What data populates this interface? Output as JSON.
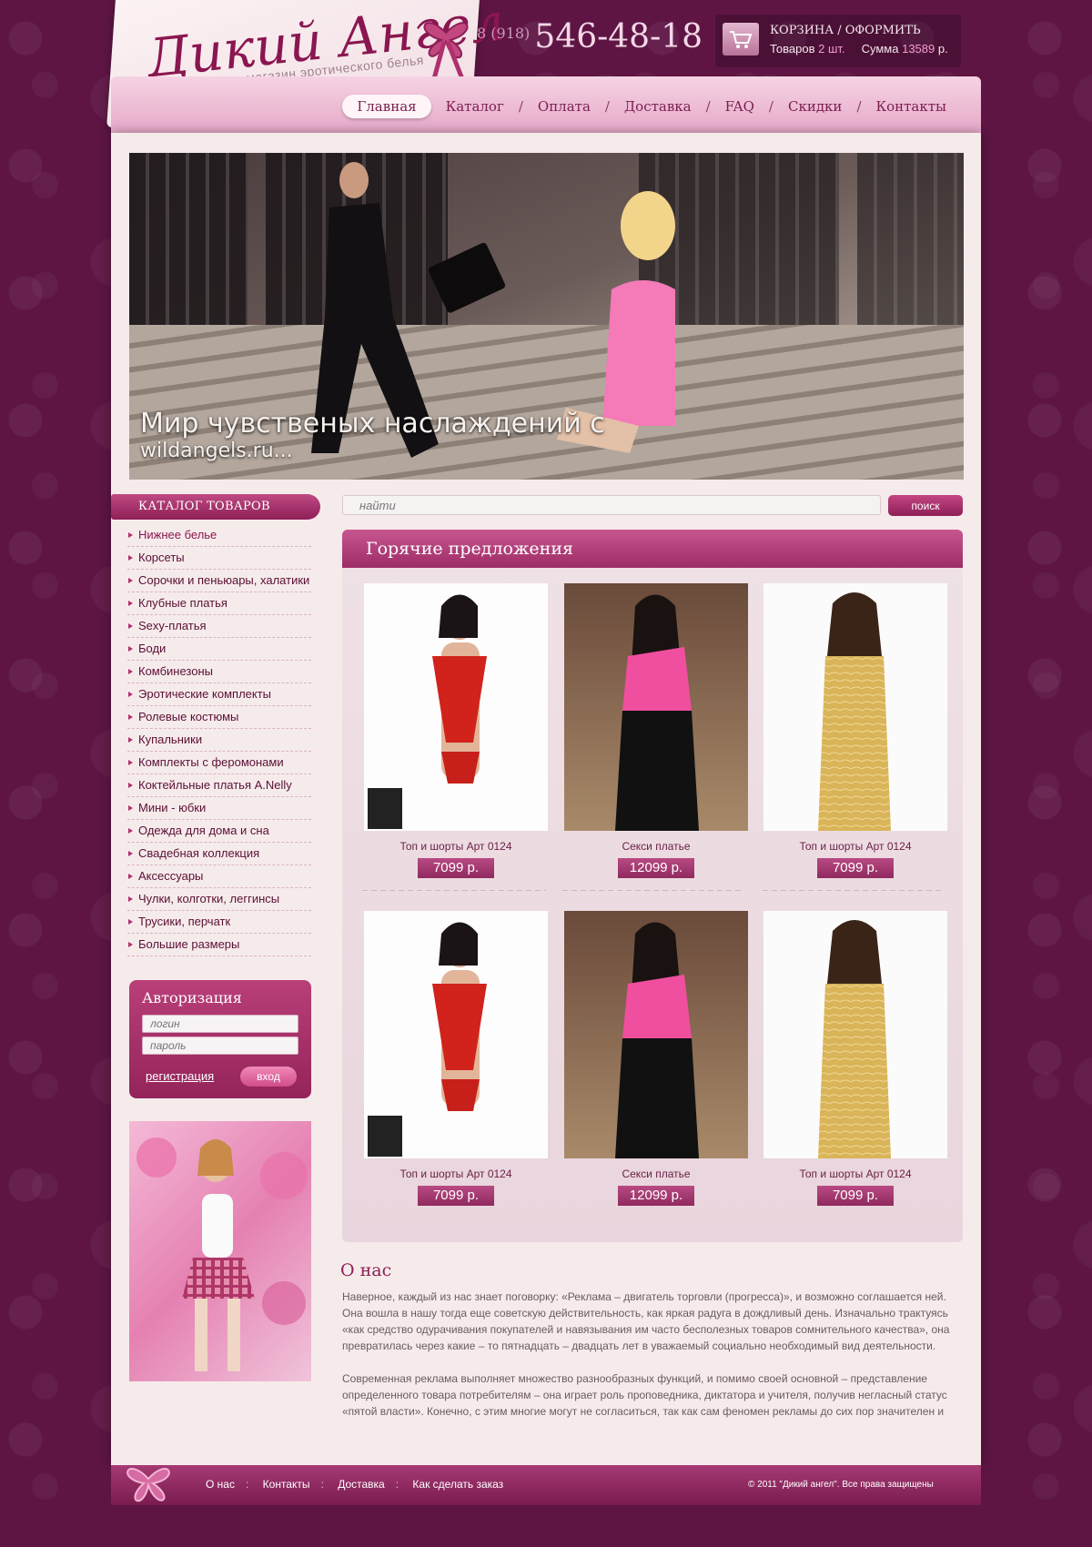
{
  "header": {
    "logo_title": "Дикий Ангел",
    "logo_subtitle": "Интернет – магазин  эротического белья",
    "phone_code": "8 (918)",
    "phone_number": "546-48-18"
  },
  "cart": {
    "title_prefix": "КОРЗИНА / ",
    "title_action": "ОФОРМИТЬ",
    "items_label": "Товаров",
    "items_count": "2 шт.",
    "sum_label": "Сумма",
    "sum_value": "13589",
    "currency": "р."
  },
  "nav": {
    "items": [
      "Главная",
      "Каталог",
      "Оплата",
      "Доставка",
      "FAQ",
      "Скидки",
      "Контакты"
    ]
  },
  "banner": {
    "line1": "Мир чувственых наслаждений с",
    "line2": "wildangels.ru..."
  },
  "sidebar": {
    "catalog_title": "КАТАЛОГ ТОВАРОВ",
    "categories": [
      "Нижнее белье",
      "Корсеты",
      "Сорочки и пеньюары, халатики",
      "Клубные платья",
      "Sexy-платья",
      "Боди",
      "Комбинезоны",
      "Эротические комплекты",
      "Ролевые костюмы",
      "Купальники",
      "Комплекты с феромонами",
      "Коктейльные платья A.Nelly",
      "Мини - юбки",
      "Одежда для дома и сна",
      "Свадебная коллекция",
      "Аксессуары",
      "Чулки, колготки, леггинсы",
      "Трусики, перчатк",
      "Большие размеры"
    ],
    "auth": {
      "title": "Авторизация",
      "login_placeholder": "логин",
      "password_placeholder": "пароль",
      "register_link": "регистрация",
      "login_button": "вход"
    }
  },
  "search": {
    "placeholder": "найти",
    "button": "поиск"
  },
  "hot_offers": {
    "title": "Горячие предложения",
    "products": [
      {
        "name": "Топ и шорты Арт 0124",
        "price": "7099 р."
      },
      {
        "name": "Секси платье",
        "price": "12099 р."
      },
      {
        "name": "Топ и шорты Арт 0124",
        "price": "7099 р."
      },
      {
        "name": "Топ и шорты Арт 0124",
        "price": "7099 р."
      },
      {
        "name": "Секси платье",
        "price": "12099 р."
      },
      {
        "name": "Топ и шорты Арт 0124",
        "price": "7099 р."
      }
    ]
  },
  "about": {
    "title": "О нас",
    "paragraphs": [
      "Наверное, каждый из нас знает поговорку: «Реклама – двигатель торговли (прогресса)», и возможно соглашается ней. Она вошла в нашу тогда еще советскую действительность, как яркая радуга в дождливый день. Изначально трактуясь «как средство одурачивания покупателей и навязывания им часто бесполезных товаров сомнительного качества», она превратилась через какие – то пятнадцать – двадцать лет в уважаемый социально необходимый вид деятельности.",
      "Современная реклама выполняет множество разнообразных функций, и помимо своей основной – представление определенного товара потребителям – она играет роль проповедника, диктатора и учителя, получив негласный статус «пятой власти». Конечно, с этим многие могут не согласиться, так как сам феномен рекламы до сих пор значителен и"
    ]
  },
  "footer": {
    "links": [
      "О нас",
      "Контакты",
      "Доставка",
      "Как сделать заказ"
    ],
    "copyright": "© 2011 \"Дикий ангел\". Все права защищены"
  }
}
